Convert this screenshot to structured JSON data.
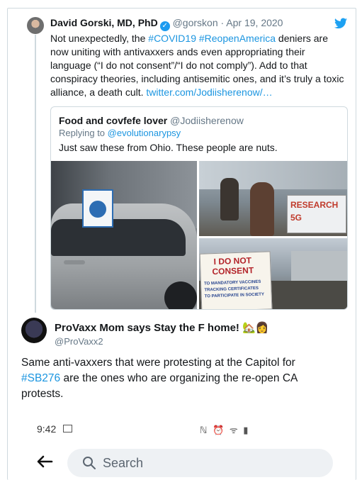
{
  "tweet1": {
    "name": "David Gorski, MD, PhD",
    "handle": "@gorskon",
    "date": "· Apr 19, 2020",
    "text_a": "Not unexpectedly, the ",
    "hashtag1": "#COVID19",
    "space": " ",
    "hashtag2": "#ReopenAmerica",
    "text_b": " deniers are now uniting with antivaxxers ands even appropriating their language (“I do not consent”/“I do not comply”). Add to that conspiracy theories, including antisemitic ones, and it’s truly a toxic alliance, a death cult. ",
    "link": "twitter.com/Jodiisherenow/…"
  },
  "quote": {
    "name": "Food and covfefe lover",
    "handle": "@Jodiisherenow",
    "replying_prefix": "Replying to ",
    "replying_handle": "@evolutionarypsy",
    "text": "Just saw these from Ohio. These people are nuts.",
    "sign_research": "RESEARCH\n5G",
    "sign_consent": "I DO NOT\nCONSENT",
    "sign_consent_small": "TO MANDATORY VACCINES\nTRACKING CERTIFICATES\nTO PARTICIPATE IN SOCIETY"
  },
  "tweet2": {
    "name": "ProVaxx Mom says Stay the F home! 🏡👩",
    "handle": "@ProVaxx2",
    "text_a": "Same anti-vaxxers that were protesting at the Capitol for ",
    "hashtag": "#SB276",
    "text_b": " are the ones who are organizing the re-open CA protests."
  },
  "phone": {
    "time": "9:42",
    "icons": "ℕ ⏰ ᯤ ▮",
    "search_placeholder": "Search"
  },
  "colors": {
    "link": "#1b95e0",
    "verified": "#1d9bf0",
    "border": "#cfd9de"
  }
}
